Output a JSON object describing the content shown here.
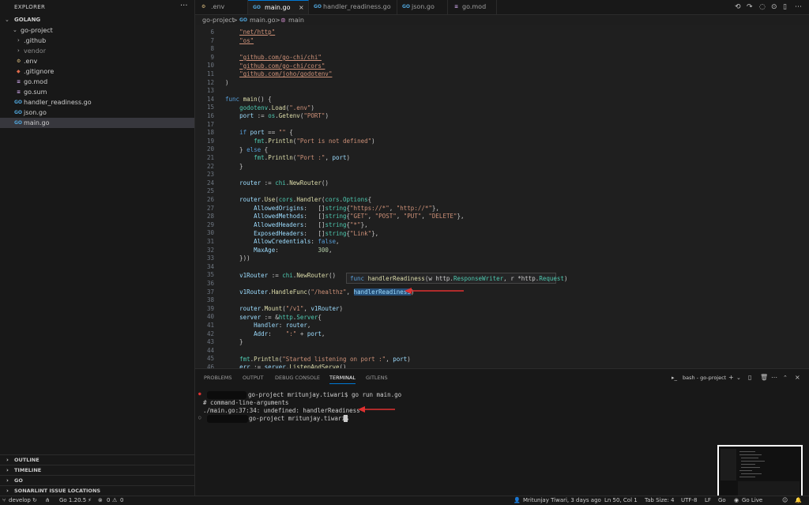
{
  "sidebar": {
    "title": "EXPLORER",
    "more": "···",
    "root": "GOLANG",
    "tree": [
      {
        "label": "go-project"
      },
      {
        "label": ".github"
      },
      {
        "label": "vendor"
      },
      {
        "label": ".env",
        "icon": "⚙"
      },
      {
        "label": ".gitignore",
        "icon": "◆"
      },
      {
        "label": "go.mod",
        "icon": "≡"
      },
      {
        "label": "go.sum",
        "icon": "≡"
      },
      {
        "label": "handler_readiness.go",
        "icon": "GO"
      },
      {
        "label": "json.go",
        "icon": "GO"
      },
      {
        "label": "main.go",
        "icon": "GO"
      }
    ],
    "sections": [
      "OUTLINE",
      "TIMELINE",
      "GO",
      "SONARLINT ISSUE LOCATIONS"
    ]
  },
  "tabs": [
    {
      "label": ".env",
      "icon": "⚙"
    },
    {
      "label": "main.go",
      "icon": "GO",
      "close": "×"
    },
    {
      "label": "handler_readiness.go",
      "icon": "GO"
    },
    {
      "label": "json.go",
      "icon": "GO"
    },
    {
      "label": "go.mod",
      "icon": "≡"
    }
  ],
  "breadcrumb": [
    "go-project",
    ">",
    "main.go",
    ">",
    "main"
  ],
  "editor": {
    "line_numbers": [
      "6",
      "7",
      "8",
      "9",
      "10",
      "11",
      "12",
      "13",
      "14",
      "15",
      "16",
      "17",
      "18",
      "19",
      "20",
      "21",
      "22",
      "23",
      "24",
      "25",
      "26",
      "27",
      "28",
      "29",
      "30",
      "31",
      "32",
      "33",
      "34",
      "35",
      "36",
      "37",
      "38",
      "39",
      "40",
      "41",
      "42",
      "43",
      "44",
      "45",
      "46"
    ],
    "hover": "func handlerReadiness(w http.ResponseWriter, r *http.Request)"
  },
  "panel": {
    "tabs": [
      "PROBLEMS",
      "OUTPUT",
      "DEBUG CONSOLE",
      "TERMINAL",
      "GITLENS"
    ],
    "shell": "bash - go-project",
    "terminal": [
      "go-project mritunjay.tiwari$ go run main.go",
      "# command-line-arguments",
      "./main.go:37:34: undefined: handlerReadiness",
      "go-project mritunjay.tiwari$"
    ]
  },
  "status": {
    "branch": "develop",
    "go_version": "Go 1.20.5",
    "errors": "0",
    "warnings": "0",
    "blame": "Mritunjay Tiwari, 3 days ago",
    "position": "Ln 50, Col 1",
    "tab_size": "Tab Size: 4",
    "encoding": "UTF-8",
    "eol": "LF",
    "language": "Go",
    "golive": "Go Live"
  }
}
